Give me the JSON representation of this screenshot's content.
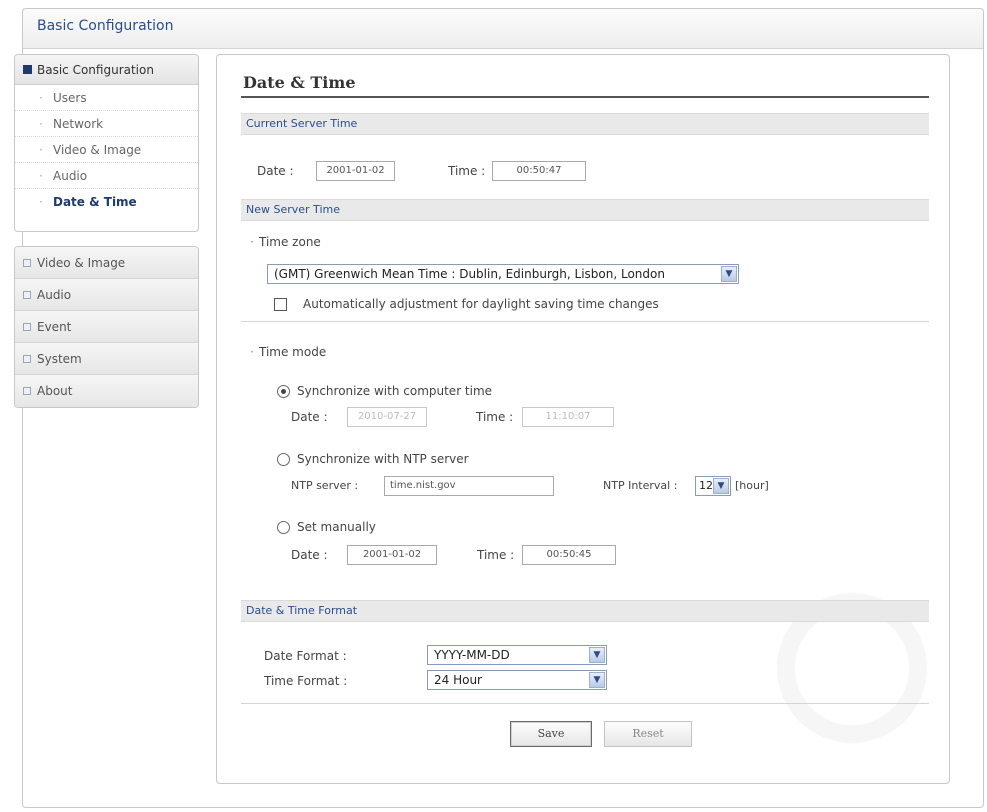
{
  "header": {
    "title": "Basic Configuration"
  },
  "sidebar": {
    "group_title": "Basic Configuration",
    "sub_items": [
      {
        "label": "Users",
        "active": false
      },
      {
        "label": "Network",
        "active": false
      },
      {
        "label": "Video & Image",
        "active": false
      },
      {
        "label": "Audio",
        "active": false
      },
      {
        "label": "Date & Time",
        "active": true
      }
    ],
    "sections": [
      {
        "label": "Video & Image"
      },
      {
        "label": "Audio"
      },
      {
        "label": "Event"
      },
      {
        "label": "System"
      },
      {
        "label": "About"
      }
    ]
  },
  "main": {
    "title": "Date & Time",
    "current_server_time": {
      "section_label": "Current Server Time",
      "date_label": "Date :",
      "date_value": "2001-01-02",
      "time_label": "Time :",
      "time_value": "00:50:47"
    },
    "new_server_time": {
      "section_label": "New Server Time",
      "timezone_label": "Time zone",
      "timezone_value": "(GMT) Greenwich Mean Time : Dublin, Edinburgh, Lisbon, London",
      "dst_label": "Automatically adjustment for daylight saving time changes",
      "dst_checked": false,
      "time_mode_label": "Time mode",
      "sync_computer": {
        "label": "Synchronize with computer time",
        "checked": true,
        "date_label": "Date :",
        "date_value": "2010-07-27",
        "time_label": "Time :",
        "time_value": "11:10:07"
      },
      "sync_ntp": {
        "label": "Synchronize with NTP server",
        "checked": false,
        "server_label": "NTP server :",
        "server_value": "time.nist.gov",
        "interval_label": "NTP Interval :",
        "interval_value": "12",
        "interval_unit": "[hour]"
      },
      "manual": {
        "label": "Set manually",
        "checked": false,
        "date_label": "Date :",
        "date_value": "2001-01-02",
        "time_label": "Time :",
        "time_value": "00:50:45"
      }
    },
    "format": {
      "section_label": "Date & Time Format",
      "date_format_label": "Date Format :",
      "date_format_value": "YYYY-MM-DD",
      "time_format_label": "Time Format :",
      "time_format_value": "24 Hour"
    },
    "buttons": {
      "save": "Save",
      "reset": "Reset"
    }
  },
  "icons": {
    "dropdown": "chevron-down-icon",
    "section_collapsed": "square-bullet-icon",
    "section_expanded": "filled-square-icon"
  },
  "colors": {
    "link_blue": "#2a4e8c",
    "active_nav": "#1f3b6d"
  }
}
